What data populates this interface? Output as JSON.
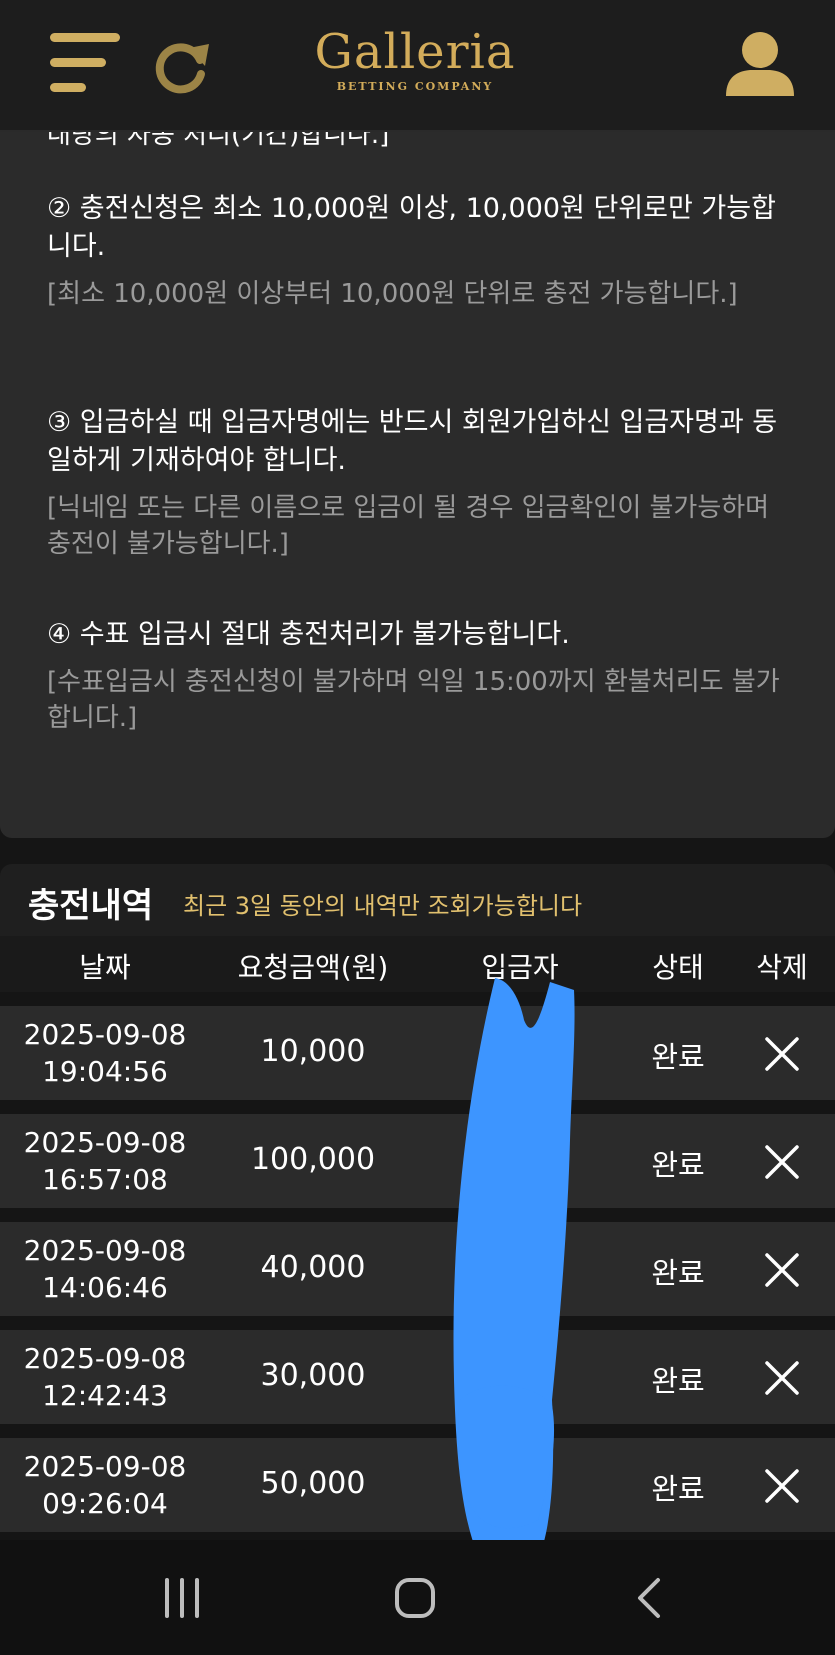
{
  "header": {
    "logo_main": "Galleria",
    "logo_sub": "BETTING COMPANY",
    "icons": {
      "menu": "menu-icon",
      "refresh": "refresh-icon",
      "user": "user-icon"
    },
    "accent_color": "#cfae62"
  },
  "notice": {
    "cut_line": "대량의 자동 처리(기간)합니다.]",
    "items": [
      {
        "main": "② 충전신청은 최소 10,000원 이상, 10,000원 단위로만 가능합니다.",
        "sub": "[최소 10,000원 이상부터 10,000원 단위로 충전 가능합니다.]"
      },
      {
        "main": "③ 입금하실 때 입금자명에는 반드시 회원가입하신 입금자명과 동일하게 기재하여야 합니다.",
        "sub": "[닉네임 또는 다른 이름으로 입금이 될 경우 입금확인이 불가능하며 충전이 불가능합니다.]"
      },
      {
        "main": "④ 수표 입금시 절대 충전처리가 불가능합니다.",
        "sub": "[수표입금시 충전신청이 불가하며 익일 15:00까지 환불처리도 불가합니다.]"
      }
    ]
  },
  "history": {
    "title": "충전내역",
    "note": "최근 3일 동안의 내역만 조회가능합니다",
    "note_color": "#e1c06e",
    "columns": [
      "날짜",
      "요청금액(원)",
      "입금자",
      "상태",
      "삭제"
    ],
    "rows": [
      {
        "date": "2025-09-08",
        "time": "19:04:56",
        "amount": "10,000",
        "depositor": "",
        "status": "완료"
      },
      {
        "date": "2025-09-08",
        "time": "16:57:08",
        "amount": "100,000",
        "depositor": "",
        "status": "완료"
      },
      {
        "date": "2025-09-08",
        "time": "14:06:46",
        "amount": "40,000",
        "depositor": "",
        "status": "완료"
      },
      {
        "date": "2025-09-08",
        "time": "12:42:43",
        "amount": "30,000",
        "depositor": "",
        "status": "완료"
      },
      {
        "date": "2025-09-08",
        "time": "09:26:04",
        "amount": "50,000",
        "depositor": "",
        "status": "완료"
      }
    ],
    "delete_icon": "close-icon",
    "redaction_color": "#3d95ff"
  },
  "navbar": {
    "icons": [
      "recent-apps-icon",
      "home-icon",
      "back-icon"
    ]
  }
}
